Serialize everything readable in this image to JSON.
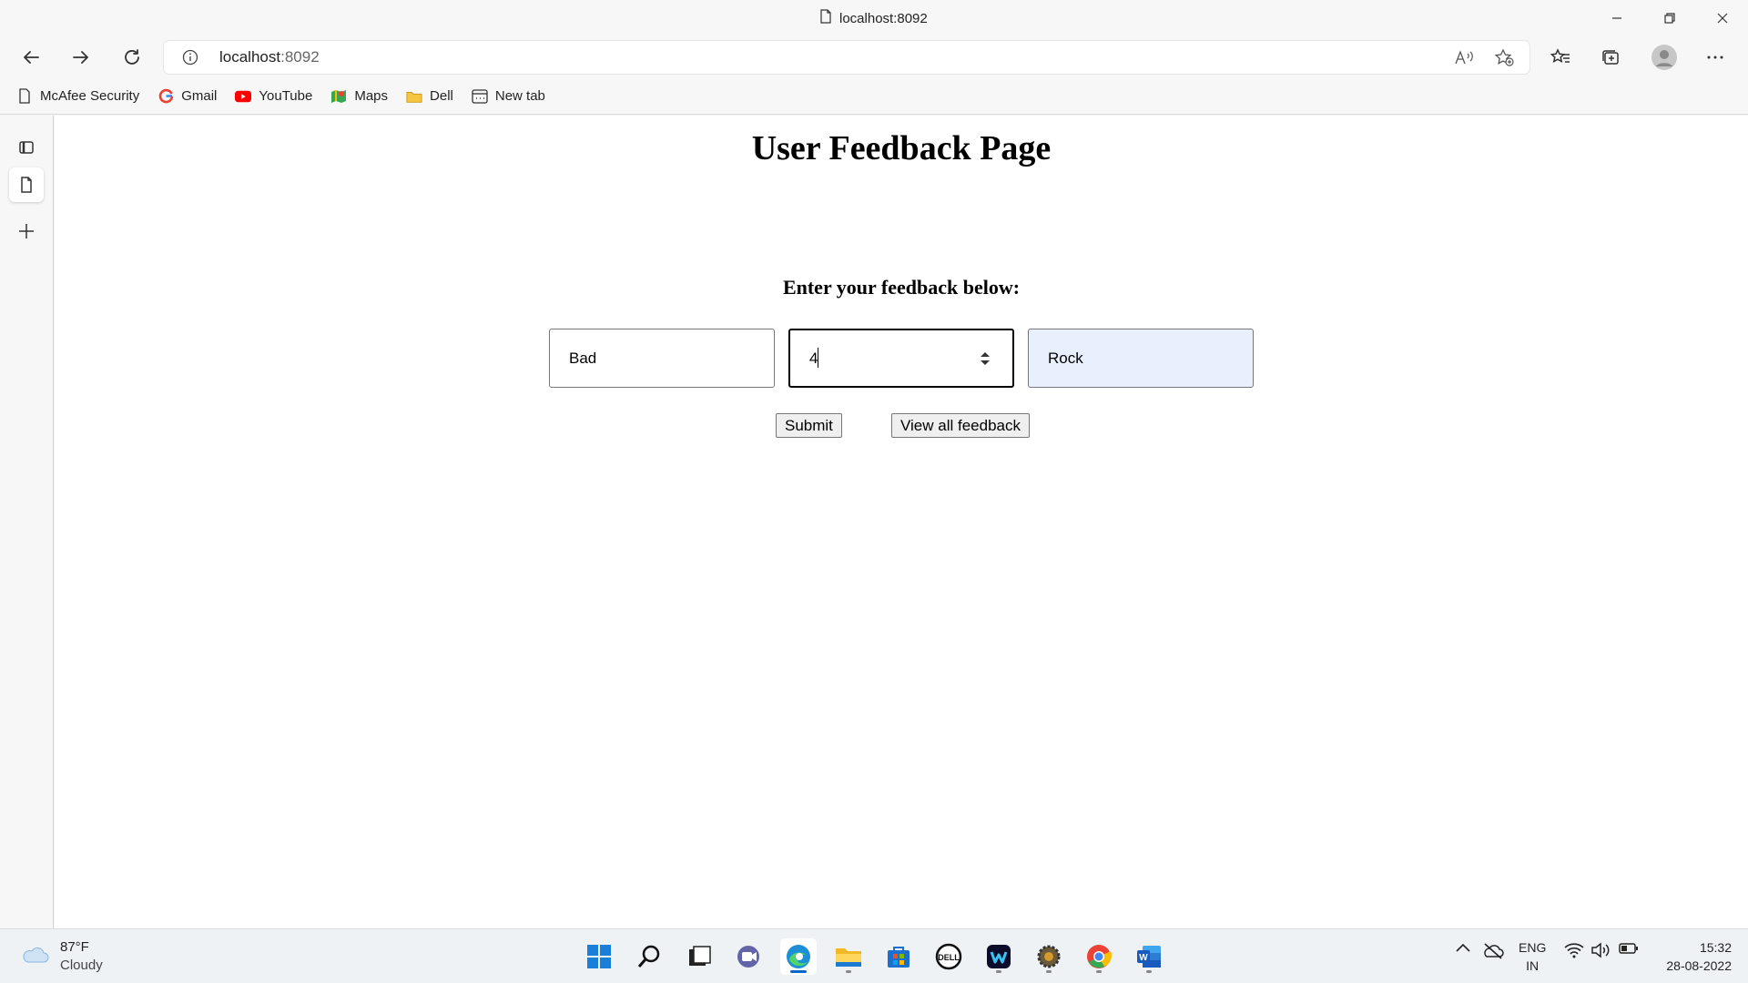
{
  "window": {
    "title": "localhost:8092"
  },
  "addressbar": {
    "host": "localhost",
    "port": ":8092"
  },
  "bookmarks": [
    {
      "label": "McAfee Security",
      "icon": "page-icon"
    },
    {
      "label": "Gmail",
      "icon": "google-icon"
    },
    {
      "label": "YouTube",
      "icon": "youtube-icon"
    },
    {
      "label": "Maps",
      "icon": "maps-icon"
    },
    {
      "label": "Dell",
      "icon": "folder-icon"
    },
    {
      "label": "New tab",
      "icon": "newtab-icon"
    }
  ],
  "page": {
    "heading": "User Feedback Page",
    "subheading": "Enter your feedback below:",
    "fields": {
      "feedback": "Bad",
      "rating": "4",
      "name": "Rock"
    },
    "buttons": {
      "submit": "Submit",
      "view_all": "View all feedback"
    }
  },
  "taskbar": {
    "weather_temp": "87°F",
    "weather_condition": "Cloudy",
    "lang_line1": "ENG",
    "lang_line2": "IN",
    "time": "15:32",
    "date": "28-08-2022"
  },
  "colors": {
    "accent": "#0a67c9",
    "autofill": "#e8f0fe"
  }
}
